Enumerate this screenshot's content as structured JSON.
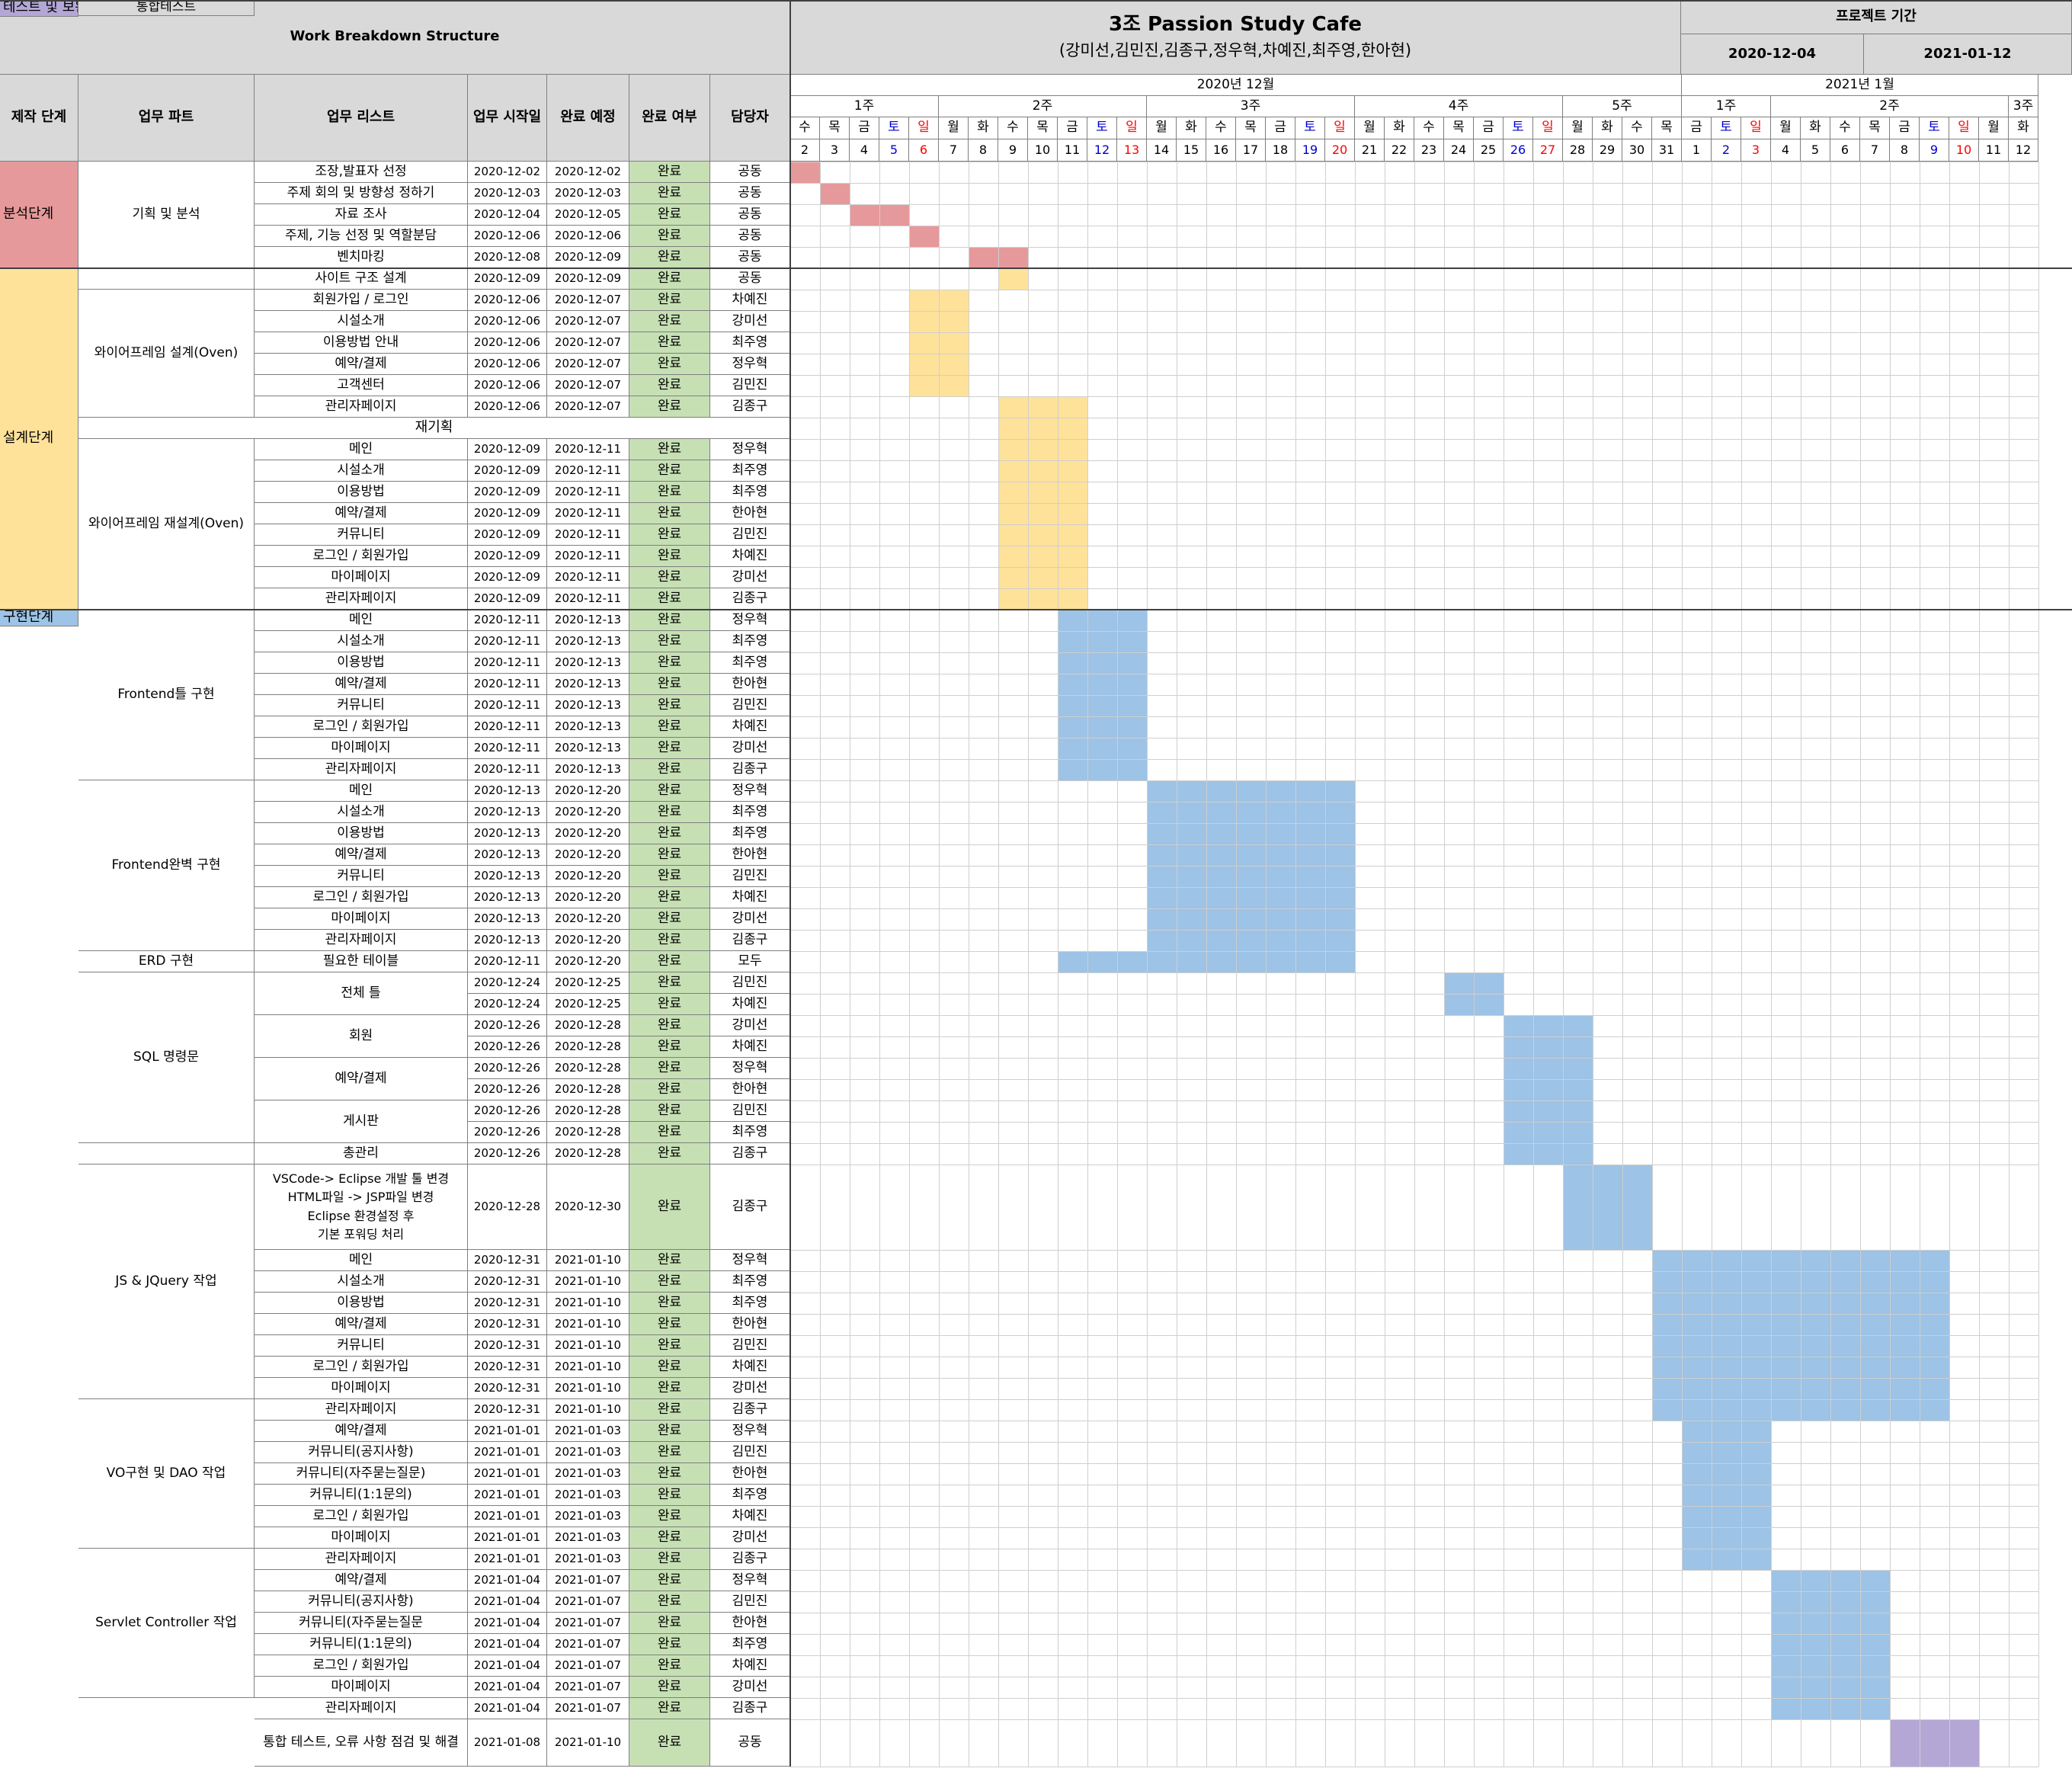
{
  "title": "Work Breakdown Structure",
  "project": {
    "name": "3조 Passion Study Cafe",
    "members": "(강미선,김민진,김종구,정우혁,차예진,최주영,한아현)",
    "period_label": "프로젝트 기간",
    "start": "2020-12-04",
    "end": "2021-01-12"
  },
  "columns": [
    "제작 단계",
    "업무 파트",
    "업무 리스트",
    "업무 시작일",
    "완료 예정",
    "완료 여부",
    "담당자"
  ],
  "months": [
    {
      "label": "2020년 12월",
      "from": 0,
      "to": 30
    },
    {
      "label": "2021년 1월",
      "from": 30,
      "to": 42
    }
  ],
  "weeks": [
    {
      "label": "1주",
      "from": 0,
      "to": 5
    },
    {
      "label": "2주",
      "from": 5,
      "to": 12
    },
    {
      "label": "3주",
      "from": 12,
      "to": 19
    },
    {
      "label": "4주",
      "from": 19,
      "to": 26
    },
    {
      "label": "5주",
      "from": 26,
      "to": 30
    },
    {
      "label": "1주",
      "from": 30,
      "to": 33
    },
    {
      "label": "2주",
      "from": 33,
      "to": 41
    },
    {
      "label": "3주",
      "from": 41,
      "to": 42
    }
  ],
  "days": [
    {
      "w": "수",
      "d": "2"
    },
    {
      "w": "목",
      "d": "3"
    },
    {
      "w": "금",
      "d": "4"
    },
    {
      "w": "토",
      "d": "5"
    },
    {
      "w": "일",
      "d": "6"
    },
    {
      "w": "월",
      "d": "7"
    },
    {
      "w": "화",
      "d": "8"
    },
    {
      "w": "수",
      "d": "9"
    },
    {
      "w": "목",
      "d": "10"
    },
    {
      "w": "금",
      "d": "11"
    },
    {
      "w": "토",
      "d": "12"
    },
    {
      "w": "일",
      "d": "13"
    },
    {
      "w": "월",
      "d": "14"
    },
    {
      "w": "화",
      "d": "15"
    },
    {
      "w": "수",
      "d": "16"
    },
    {
      "w": "목",
      "d": "17"
    },
    {
      "w": "금",
      "d": "18"
    },
    {
      "w": "토",
      "d": "19"
    },
    {
      "w": "일",
      "d": "20"
    },
    {
      "w": "월",
      "d": "21"
    },
    {
      "w": "화",
      "d": "22"
    },
    {
      "w": "수",
      "d": "23"
    },
    {
      "w": "목",
      "d": "24"
    },
    {
      "w": "금",
      "d": "25"
    },
    {
      "w": "토",
      "d": "26"
    },
    {
      "w": "일",
      "d": "27"
    },
    {
      "w": "월",
      "d": "28"
    },
    {
      "w": "화",
      "d": "29"
    },
    {
      "w": "수",
      "d": "30"
    },
    {
      "w": "목",
      "d": "31"
    },
    {
      "w": "금",
      "d": "1"
    },
    {
      "w": "토",
      "d": "2"
    },
    {
      "w": "일",
      "d": "3"
    },
    {
      "w": "월",
      "d": "4"
    },
    {
      "w": "화",
      "d": "5"
    },
    {
      "w": "수",
      "d": "6"
    },
    {
      "w": "목",
      "d": "7"
    },
    {
      "w": "금",
      "d": "8"
    },
    {
      "w": "토",
      "d": "9"
    },
    {
      "w": "일",
      "d": "10"
    },
    {
      "w": "월",
      "d": "11"
    },
    {
      "w": "화",
      "d": "12"
    }
  ],
  "colors": {
    "analysis": "#e6999a",
    "design": "#ffe29a",
    "implementation": "#9dc3e6",
    "test": "#b4a7d6",
    "done": "#c6e0b4",
    "saturday": "#0000cc",
    "sunday": "#ff0000"
  },
  "stages": [
    {
      "label": "분석단계",
      "from": 0,
      "to": 5,
      "color": "analysis"
    },
    {
      "label": "설계단계",
      "from": 5,
      "to": 21,
      "color": "design"
    },
    {
      "label": "구현단계",
      "from": 21,
      "to": 74,
      "color": "implementation"
    },
    {
      "label": "테스트 및 보완",
      "from": 74,
      "to": 75,
      "color": "test"
    }
  ],
  "parts": [
    {
      "label": "기획 및 분석",
      "from": 0,
      "to": 5
    },
    {
      "label": "",
      "from": 5,
      "to": 6
    },
    {
      "label": "와이어프레임 설계(Oven)",
      "from": 6,
      "to": 12
    },
    {
      "label": "와이어프레임 재설계(Oven)",
      "from": 13,
      "to": 21
    },
    {
      "label": "Frontend틀 구현",
      "from": 21,
      "to": 29
    },
    {
      "label": "Frontend완벽 구현",
      "from": 29,
      "to": 37
    },
    {
      "label": "ERD 구현",
      "from": 37,
      "to": 38
    },
    {
      "label": "SQL 명령문",
      "from": 38,
      "to": 46
    },
    {
      "label": "",
      "from": 46,
      "to": 47
    },
    {
      "label": "JS & JQuery 작업",
      "from": 47,
      "to": 55
    },
    {
      "label": "VO구현 및 DAO 작업",
      "from": 55,
      "to": 62
    },
    {
      "label": "Servlet Controller 작업",
      "from": 62,
      "to": 69
    },
    {
      "label": "통합테스트",
      "from": 74,
      "to": 75
    }
  ],
  "separator": {
    "label": "재기획",
    "row": 12
  },
  "rows": [
    {
      "task": "조장,발표자 선정",
      "start": "2020-12-02",
      "end": "2020-12-02",
      "status": "완료",
      "owner": "공동",
      "bar": [
        0,
        1
      ],
      "color": "analysis"
    },
    {
      "task": "주제 회의 및 방향성 정하기",
      "start": "2020-12-03",
      "end": "2020-12-03",
      "status": "완료",
      "owner": "공동",
      "bar": [
        1,
        2
      ],
      "color": "analysis"
    },
    {
      "task": "자료 조사",
      "start": "2020-12-04",
      "end": "2020-12-05",
      "status": "완료",
      "owner": "공동",
      "bar": [
        2,
        4
      ],
      "color": "analysis"
    },
    {
      "task": "주제, 기능 선정 및 역할분담",
      "start": "2020-12-06",
      "end": "2020-12-06",
      "status": "완료",
      "owner": "공동",
      "bar": [
        4,
        5
      ],
      "color": "analysis"
    },
    {
      "task": "벤치마킹",
      "start": "2020-12-08",
      "end": "2020-12-09",
      "status": "완료",
      "owner": "공동",
      "bar": [
        6,
        8
      ],
      "color": "analysis"
    },
    {
      "task": "사이트 구조 설계",
      "start": "2020-12-09",
      "end": "2020-12-09",
      "status": "완료",
      "owner": "공동",
      "bar": [
        7,
        8
      ],
      "color": "design"
    },
    {
      "task": "회원가입 / 로그인",
      "start": "2020-12-06",
      "end": "2020-12-07",
      "status": "완료",
      "owner": "차예진",
      "bar": [
        4,
        6
      ],
      "color": "design"
    },
    {
      "task": "시설소개",
      "start": "2020-12-06",
      "end": "2020-12-07",
      "status": "완료",
      "owner": "강미선",
      "bar": [
        4,
        6
      ],
      "color": "design"
    },
    {
      "task": "이용방법 안내",
      "start": "2020-12-06",
      "end": "2020-12-07",
      "status": "완료",
      "owner": "최주영",
      "bar": [
        4,
        6
      ],
      "color": "design"
    },
    {
      "task": "예약/결제",
      "start": "2020-12-06",
      "end": "2020-12-07",
      "status": "완료",
      "owner": "정우혁",
      "bar": [
        4,
        6
      ],
      "color": "design"
    },
    {
      "task": "고객센터",
      "start": "2020-12-06",
      "end": "2020-12-07",
      "status": "완료",
      "owner": "김민진",
      "bar": [
        4,
        6
      ],
      "color": "design"
    },
    {
      "task": "관리자페이지",
      "start": "2020-12-06",
      "end": "2020-12-07",
      "status": "완료",
      "owner": "김종구",
      "bar": [
        7,
        10
      ],
      "color": "design"
    },
    {
      "task": "",
      "start": "",
      "end": "",
      "status": "",
      "owner": "",
      "bar": [
        7,
        10
      ],
      "color": "design"
    },
    {
      "task": "메인",
      "start": "2020-12-09",
      "end": "2020-12-11",
      "status": "완료",
      "owner": "정우혁",
      "bar": [
        7,
        10
      ],
      "color": "design"
    },
    {
      "task": "시설소개",
      "start": "2020-12-09",
      "end": "2020-12-11",
      "status": "완료",
      "owner": "최주영",
      "bar": [
        7,
        10
      ],
      "color": "design"
    },
    {
      "task": "이용방법",
      "start": "2020-12-09",
      "end": "2020-12-11",
      "status": "완료",
      "owner": "최주영",
      "bar": [
        7,
        10
      ],
      "color": "design"
    },
    {
      "task": "예약/결제",
      "start": "2020-12-09",
      "end": "2020-12-11",
      "status": "완료",
      "owner": "한아현",
      "bar": [
        7,
        10
      ],
      "color": "design"
    },
    {
      "task": "커뮤니티",
      "start": "2020-12-09",
      "end": "2020-12-11",
      "status": "완료",
      "owner": "김민진",
      "bar": [
        7,
        10
      ],
      "color": "design"
    },
    {
      "task": "로그인 / 회원가입",
      "start": "2020-12-09",
      "end": "2020-12-11",
      "status": "완료",
      "owner": "차예진",
      "bar": [
        7,
        10
      ],
      "color": "design"
    },
    {
      "task": "마이페이지",
      "start": "2020-12-09",
      "end": "2020-12-11",
      "status": "완료",
      "owner": "강미선",
      "bar": [
        7,
        10
      ],
      "color": "design"
    },
    {
      "task": "관리자페이지",
      "start": "2020-12-09",
      "end": "2020-12-11",
      "status": "완료",
      "owner": "김종구",
      "bar": [
        7,
        10
      ],
      "color": "design"
    },
    {
      "task": "메인",
      "start": "2020-12-11",
      "end": "2020-12-13",
      "status": "완료",
      "owner": "정우혁",
      "bar": [
        9,
        12
      ],
      "color": "implementation"
    },
    {
      "task": "시설소개",
      "start": "2020-12-11",
      "end": "2020-12-13",
      "status": "완료",
      "owner": "최주영",
      "bar": [
        9,
        12
      ],
      "color": "implementation"
    },
    {
      "task": "이용방법",
      "start": "2020-12-11",
      "end": "2020-12-13",
      "status": "완료",
      "owner": "최주영",
      "bar": [
        9,
        12
      ],
      "color": "implementation"
    },
    {
      "task": "예약/결제",
      "start": "2020-12-11",
      "end": "2020-12-13",
      "status": "완료",
      "owner": "한아현",
      "bar": [
        9,
        12
      ],
      "color": "implementation"
    },
    {
      "task": "커뮤니티",
      "start": "2020-12-11",
      "end": "2020-12-13",
      "status": "완료",
      "owner": "김민진",
      "bar": [
        9,
        12
      ],
      "color": "implementation"
    },
    {
      "task": "로그인 / 회원가입",
      "start": "2020-12-11",
      "end": "2020-12-13",
      "status": "완료",
      "owner": "차예진",
      "bar": [
        9,
        12
      ],
      "color": "implementation"
    },
    {
      "task": "마이페이지",
      "start": "2020-12-11",
      "end": "2020-12-13",
      "status": "완료",
      "owner": "강미선",
      "bar": [
        9,
        12
      ],
      "color": "implementation"
    },
    {
      "task": "관리자페이지",
      "start": "2020-12-11",
      "end": "2020-12-13",
      "status": "완료",
      "owner": "김종구",
      "bar": [
        9,
        12
      ],
      "color": "implementation"
    },
    {
      "task": "메인",
      "start": "2020-12-13",
      "end": "2020-12-20",
      "status": "완료",
      "owner": "정우혁",
      "bar": [
        12,
        19
      ],
      "color": "implementation"
    },
    {
      "task": "시설소개",
      "start": "2020-12-13",
      "end": "2020-12-20",
      "status": "완료",
      "owner": "최주영",
      "bar": [
        12,
        19
      ],
      "color": "implementation"
    },
    {
      "task": "이용방법",
      "start": "2020-12-13",
      "end": "2020-12-20",
      "status": "완료",
      "owner": "최주영",
      "bar": [
        12,
        19
      ],
      "color": "implementation"
    },
    {
      "task": "예약/결제",
      "start": "2020-12-13",
      "end": "2020-12-20",
      "status": "완료",
      "owner": "한아현",
      "bar": [
        12,
        19
      ],
      "color": "implementation"
    },
    {
      "task": "커뮤니티",
      "start": "2020-12-13",
      "end": "2020-12-20",
      "status": "완료",
      "owner": "김민진",
      "bar": [
        12,
        19
      ],
      "color": "implementation"
    },
    {
      "task": "로그인 / 회원가입",
      "start": "2020-12-13",
      "end": "2020-12-20",
      "status": "완료",
      "owner": "차예진",
      "bar": [
        12,
        19
      ],
      "color": "implementation"
    },
    {
      "task": "마이페이지",
      "start": "2020-12-13",
      "end": "2020-12-20",
      "status": "완료",
      "owner": "강미선",
      "bar": [
        12,
        19
      ],
      "color": "implementation"
    },
    {
      "task": "관리자페이지",
      "start": "2020-12-13",
      "end": "2020-12-20",
      "status": "완료",
      "owner": "김종구",
      "bar": [
        12,
        19
      ],
      "color": "implementation"
    },
    {
      "task": "필요한 테이블",
      "start": "2020-12-11",
      "end": "2020-12-20",
      "status": "완료",
      "owner": "모두",
      "bar": [
        9,
        19
      ],
      "color": "implementation"
    },
    {
      "task": "전체 틀",
      "start": "2020-12-24",
      "end": "2020-12-25",
      "status": "완료",
      "owner": "김민진",
      "bar": [
        22,
        24
      ],
      "color": "implementation"
    },
    {
      "task": "",
      "start": "2020-12-24",
      "end": "2020-12-25",
      "status": "완료",
      "owner": "차예진",
      "bar": [
        22,
        24
      ],
      "color": "implementation"
    },
    {
      "task": "회원",
      "start": "2020-12-26",
      "end": "2020-12-28",
      "status": "완료",
      "owner": "강미선",
      "bar": [
        24,
        27
      ],
      "color": "implementation"
    },
    {
      "task": "",
      "start": "2020-12-26",
      "end": "2020-12-28",
      "status": "완료",
      "owner": "차예진",
      "bar": [
        24,
        27
      ],
      "color": "implementation"
    },
    {
      "task": "예약/결제",
      "start": "2020-12-26",
      "end": "2020-12-28",
      "status": "완료",
      "owner": "정우혁",
      "bar": [
        24,
        27
      ],
      "color": "implementation"
    },
    {
      "task": "",
      "start": "2020-12-26",
      "end": "2020-12-28",
      "status": "완료",
      "owner": "한아현",
      "bar": [
        24,
        27
      ],
      "color": "implementation"
    },
    {
      "task": "게시판",
      "start": "2020-12-26",
      "end": "2020-12-28",
      "status": "완료",
      "owner": "김민진",
      "bar": [
        24,
        27
      ],
      "color": "implementation"
    },
    {
      "task": "",
      "start": "2020-12-26",
      "end": "2020-12-28",
      "status": "완료",
      "owner": "최주영",
      "bar": [
        24,
        27
      ],
      "color": "implementation"
    },
    {
      "task": "총관리",
      "start": "2020-12-26",
      "end": "2020-12-28",
      "status": "완료",
      "owner": "김종구",
      "bar": [
        24,
        27
      ],
      "color": "implementation"
    },
    {
      "task": "",
      "start": "2020-12-28",
      "end": "2020-12-30",
      "status": "완료",
      "owner": "김종구",
      "bar": [
        26,
        29
      ],
      "color": "implementation",
      "tall": 4,
      "lines": [
        "VSCode-> Eclipse 개발 툴 변경",
        "HTML파일 -> JSP파일 변경",
        "Eclipse 환경설정 후",
        "기본 포워딩 처리"
      ]
    },
    {
      "task": "메인",
      "start": "2020-12-31",
      "end": "2021-01-10",
      "status": "완료",
      "owner": "정우혁",
      "bar": [
        29,
        39
      ],
      "color": "implementation"
    },
    {
      "task": "시설소개",
      "start": "2020-12-31",
      "end": "2021-01-10",
      "status": "완료",
      "owner": "최주영",
      "bar": [
        29,
        39
      ],
      "color": "implementation"
    },
    {
      "task": "이용방법",
      "start": "2020-12-31",
      "end": "2021-01-10",
      "status": "완료",
      "owner": "최주영",
      "bar": [
        29,
        39
      ],
      "color": "implementation"
    },
    {
      "task": "예약/결제",
      "start": "2020-12-31",
      "end": "2021-01-10",
      "status": "완료",
      "owner": "한아현",
      "bar": [
        29,
        39
      ],
      "color": "implementation"
    },
    {
      "task": "커뮤니티",
      "start": "2020-12-31",
      "end": "2021-01-10",
      "status": "완료",
      "owner": "김민진",
      "bar": [
        29,
        39
      ],
      "color": "implementation"
    },
    {
      "task": "로그인 / 회원가입",
      "start": "2020-12-31",
      "end": "2021-01-10",
      "status": "완료",
      "owner": "차예진",
      "bar": [
        29,
        39
      ],
      "color": "implementation"
    },
    {
      "task": "마이페이지",
      "start": "2020-12-31",
      "end": "2021-01-10",
      "status": "완료",
      "owner": "강미선",
      "bar": [
        29,
        39
      ],
      "color": "implementation"
    },
    {
      "task": "관리자페이지",
      "start": "2020-12-31",
      "end": "2021-01-10",
      "status": "완료",
      "owner": "김종구",
      "bar": [
        29,
        39
      ],
      "color": "implementation"
    },
    {
      "task": "예약/결제",
      "start": "2021-01-01",
      "end": "2021-01-03",
      "status": "완료",
      "owner": "정우혁",
      "bar": [
        30,
        33
      ],
      "color": "implementation"
    },
    {
      "task": "커뮤니티(공지사항)",
      "start": "2021-01-01",
      "end": "2021-01-03",
      "status": "완료",
      "owner": "김민진",
      "bar": [
        30,
        33
      ],
      "color": "implementation"
    },
    {
      "task": "커뮤니티(자주묻는질문)",
      "start": "2021-01-01",
      "end": "2021-01-03",
      "status": "완료",
      "owner": "한아현",
      "bar": [
        30,
        33
      ],
      "color": "implementation"
    },
    {
      "task": "커뮤니티(1:1문의)",
      "start": "2021-01-01",
      "end": "2021-01-03",
      "status": "완료",
      "owner": "최주영",
      "bar": [
        30,
        33
      ],
      "color": "implementation"
    },
    {
      "task": "로그인 / 회원가입",
      "start": "2021-01-01",
      "end": "2021-01-03",
      "status": "완료",
      "owner": "차예진",
      "bar": [
        30,
        33
      ],
      "color": "implementation"
    },
    {
      "task": "마이페이지",
      "start": "2021-01-01",
      "end": "2021-01-03",
      "status": "완료",
      "owner": "강미선",
      "bar": [
        30,
        33
      ],
      "color": "implementation"
    },
    {
      "task": "관리자페이지",
      "start": "2021-01-01",
      "end": "2021-01-03",
      "status": "완료",
      "owner": "김종구",
      "bar": [
        30,
        33
      ],
      "color": "implementation"
    },
    {
      "task": "예약/결제",
      "start": "2021-01-04",
      "end": "2021-01-07",
      "status": "완료",
      "owner": "정우혁",
      "bar": [
        33,
        37
      ],
      "color": "implementation"
    },
    {
      "task": "커뮤니티(공지사항)",
      "start": "2021-01-04",
      "end": "2021-01-07",
      "status": "완료",
      "owner": "김민진",
      "bar": [
        33,
        37
      ],
      "color": "implementation"
    },
    {
      "task": "커뮤니티(자주묻는질문",
      "start": "2021-01-04",
      "end": "2021-01-07",
      "status": "완료",
      "owner": "한아현",
      "bar": [
        33,
        37
      ],
      "color": "implementation"
    },
    {
      "task": "커뮤니티(1:1문의)",
      "start": "2021-01-04",
      "end": "2021-01-07",
      "status": "완료",
      "owner": "최주영",
      "bar": [
        33,
        37
      ],
      "color": "implementation"
    },
    {
      "task": "로그인 / 회원가입",
      "start": "2021-01-04",
      "end": "2021-01-07",
      "status": "완료",
      "owner": "차예진",
      "bar": [
        33,
        37
      ],
      "color": "implementation"
    },
    {
      "task": "마이페이지",
      "start": "2021-01-04",
      "end": "2021-01-07",
      "status": "완료",
      "owner": "강미선",
      "bar": [
        33,
        37
      ],
      "color": "implementation"
    },
    {
      "task": "관리자페이지",
      "start": "2021-01-04",
      "end": "2021-01-07",
      "status": "완료",
      "owner": "김종구",
      "bar": [
        33,
        37
      ],
      "color": "implementation"
    },
    {
      "task": "통합 테스트, 오류 사항 점검 및 해결",
      "start": "2021-01-08",
      "end": "2021-01-10",
      "status": "완료",
      "owner": "공동",
      "bar": [
        37,
        40
      ],
      "color": "test",
      "tall": 2.2
    }
  ]
}
